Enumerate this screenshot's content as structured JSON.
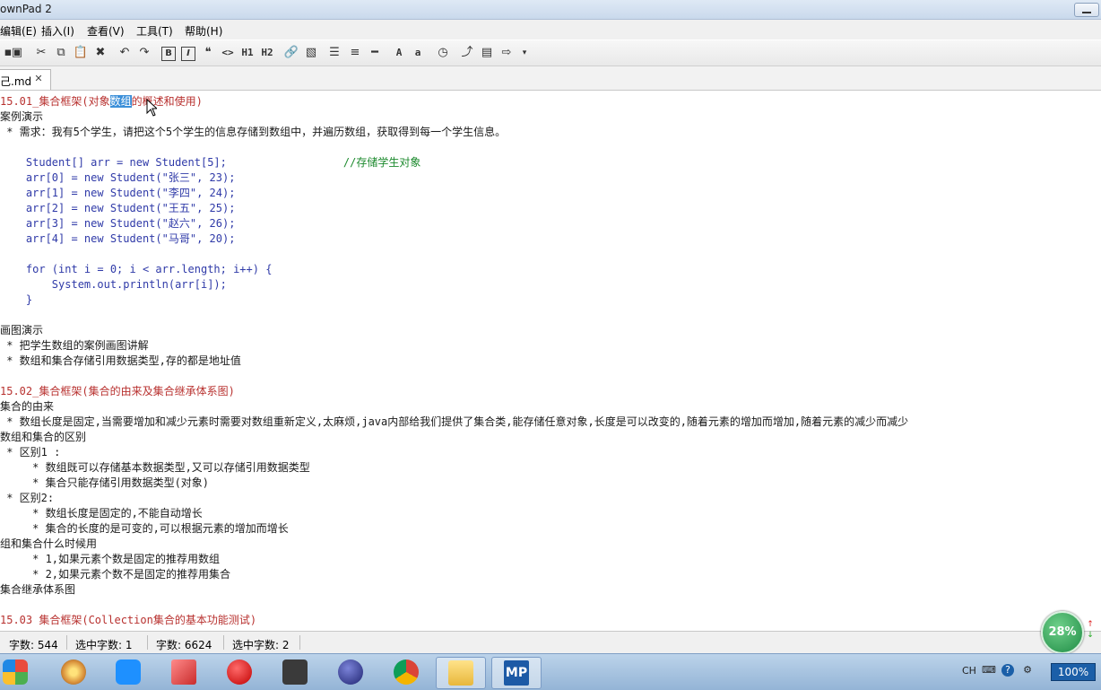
{
  "window": {
    "title": "ownPad 2"
  },
  "menu": [
    "编辑(E)",
    "插入(I)",
    "查看(V)",
    "工具(T)",
    "帮助(H)"
  ],
  "toolbar": {
    "h1": "H1",
    "h2": "H2",
    "bold": "B",
    "italic": "I",
    "text_large": "A",
    "text_small": "a",
    "quote": "❝",
    "code": "<>"
  },
  "tab": {
    "label": "己.md",
    "close": "✕"
  },
  "editor": {
    "lines": [
      {
        "text": "15.01_集合框架(对象数组的概述和使用)",
        "style": "heading"
      },
      {
        "text": "案例演示",
        "style": "normal"
      },
      {
        "text": " * 需求：我有5个学生，请把这个5个学生的信息存储到数组中，并遍历数组，获取得到每一个学生信息。",
        "style": "normal"
      },
      {
        "text": "",
        "style": "normal"
      },
      {
        "text": "    Student[] arr = new Student[5];                  ",
        "comment": "//存储学生对象",
        "style": "code"
      },
      {
        "text": "    arr[0] = new Student(\"张三\", 23);",
        "style": "code"
      },
      {
        "text": "    arr[1] = new Student(\"李四\", 24);",
        "style": "code"
      },
      {
        "text": "    arr[2] = new Student(\"王五\", 25);",
        "style": "code"
      },
      {
        "text": "    arr[3] = new Student(\"赵六\", 26);",
        "style": "code"
      },
      {
        "text": "    arr[4] = new Student(\"马哥\", 20);",
        "style": "code"
      },
      {
        "text": "",
        "style": "normal"
      },
      {
        "text": "    for (int i = 0; i < arr.length; i++) {",
        "style": "code"
      },
      {
        "text": "        System.out.println(arr[i]);",
        "style": "code"
      },
      {
        "text": "    }",
        "style": "code"
      },
      {
        "text": "",
        "style": "normal"
      },
      {
        "text": "画图演示",
        "style": "normal"
      },
      {
        "text": " * 把学生数组的案例画图讲解",
        "style": "normal"
      },
      {
        "text": " * 数组和集合存储引用数据类型,存的都是地址值",
        "style": "normal"
      },
      {
        "text": "",
        "style": "normal"
      },
      {
        "text": "15.02_集合框架(集合的由来及集合继承体系图)",
        "style": "heading"
      },
      {
        "text": "集合的由来",
        "style": "normal"
      },
      {
        "text": " * 数组长度是固定,当需要增加和减少元素时需要对数组重新定义,太麻烦,java内部给我们提供了集合类,能存储任意对象,长度是可以改变的,随着元素的增加而增加,随着元素的减少而减少",
        "style": "normal"
      },
      {
        "text": "数组和集合的区别",
        "style": "normal"
      },
      {
        "text": " * 区别1 :",
        "style": "normal"
      },
      {
        "text": "     * 数组既可以存储基本数据类型,又可以存储引用数据类型",
        "style": "normal"
      },
      {
        "text": "     * 集合只能存储引用数据类型(对象)",
        "style": "normal"
      },
      {
        "text": " * 区别2:",
        "style": "normal"
      },
      {
        "text": "     * 数组长度是固定的,不能自动增长",
        "style": "normal"
      },
      {
        "text": "     * 集合的长度的是可变的,可以根据元素的增加而增长",
        "style": "normal"
      },
      {
        "text": "组和集合什么时候用",
        "style": "normal"
      },
      {
        "text": "     * 1,如果元素个数是固定的推荐用数组",
        "style": "normal"
      },
      {
        "text": "     * 2,如果元素个数不是固定的推荐用集合",
        "style": "normal"
      },
      {
        "text": "集合继承体系图",
        "style": "normal"
      },
      {
        "text": "",
        "style": "normal"
      },
      {
        "text": "15.03 集合框架(Collection集合的基本功能测试)",
        "style": "heading"
      }
    ],
    "selection": {
      "line": 0,
      "text": "数组"
    }
  },
  "status": [
    {
      "label": "字数: 544"
    },
    {
      "label": "选中字数: 1"
    },
    {
      "label": "字数: 6624"
    },
    {
      "label": "选中字数: 2"
    }
  ],
  "zoom_badge": "28%",
  "taskbar": {
    "tray_lang": "CH",
    "tray_zoom": "100%",
    "mp_label": "MP",
    "colors": {
      "taskbar_bg": "#a9c4e0",
      "heading": "#b8312f",
      "code": "#2f3aa8",
      "comment": "#1d8a2e",
      "selection": "#3b8fd9"
    }
  }
}
